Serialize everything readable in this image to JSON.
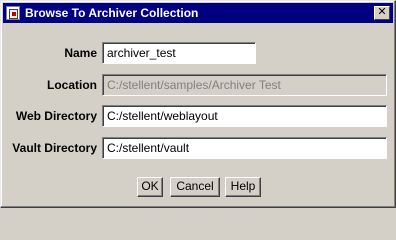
{
  "window": {
    "title": "Browse To Archiver Collection",
    "close_glyph": "✕",
    "colors": {
      "titlebar": "#000080",
      "face": "#d4d0c8",
      "disabled_text": "#808080"
    }
  },
  "form": {
    "name": {
      "label": "Name",
      "value": "archiver_test"
    },
    "location": {
      "label": "Location",
      "value": "C:/stellent/samples/Archiver Test",
      "disabled": true
    },
    "web_directory": {
      "label": "Web Directory",
      "value": "C:/stellent/weblayout"
    },
    "vault_directory": {
      "label": "Vault Directory",
      "value": "C:/stellent/vault"
    }
  },
  "buttons": {
    "ok": "OK",
    "cancel": "Cancel",
    "help": "Help"
  }
}
